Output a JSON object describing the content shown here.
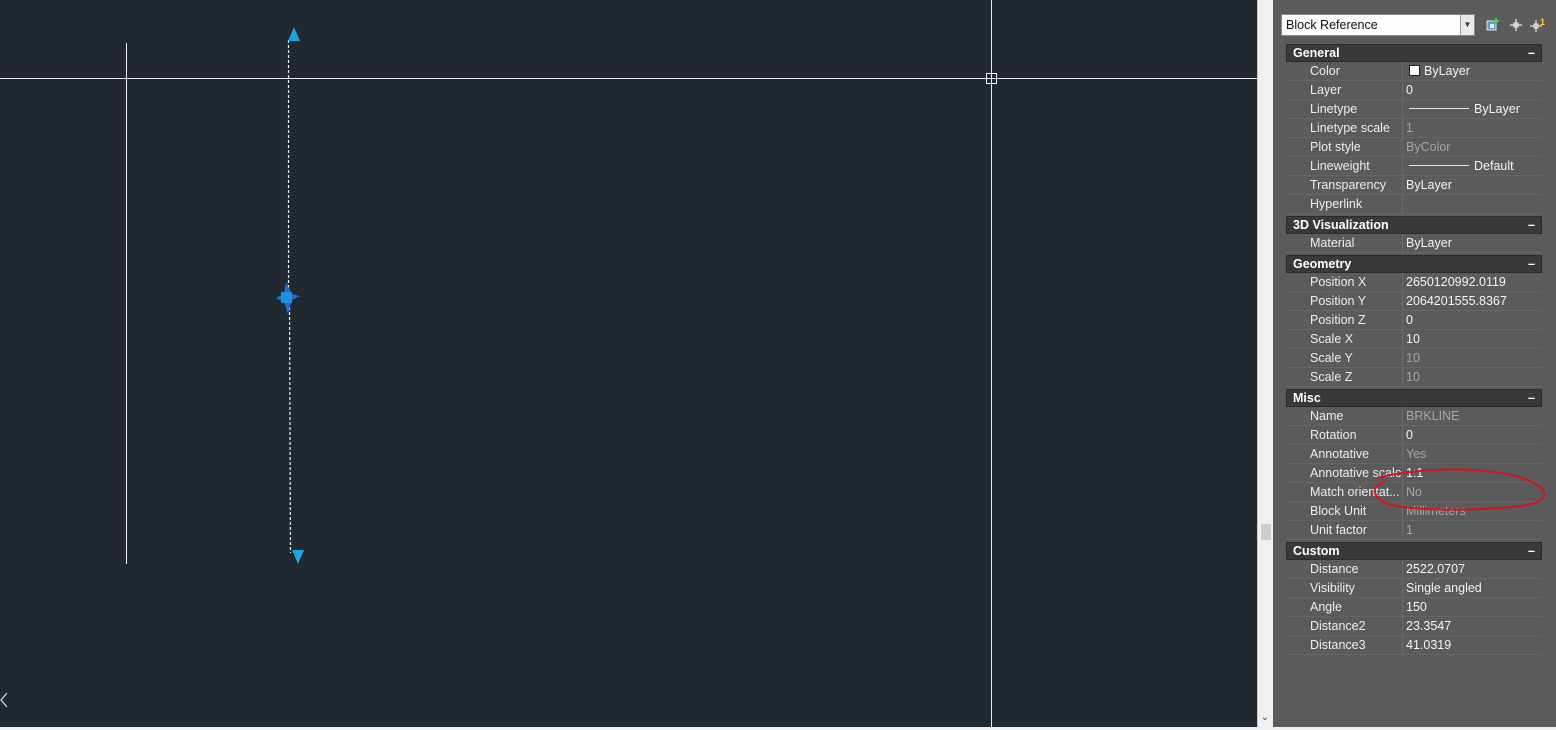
{
  "palette": {
    "object_type": "Block Reference",
    "toolbar": {
      "icons": [
        "quick-select-icon",
        "select-objects-icon",
        "toggle-pickadd-icon"
      ]
    },
    "categories": [
      {
        "title": "General",
        "collapse_symbol": "–",
        "rows": [
          {
            "name": "Color",
            "value": "ByLayer",
            "swatch": "#ffffff",
            "readonly": false
          },
          {
            "name": "Layer",
            "value": "0",
            "readonly": false
          },
          {
            "name": "Linetype",
            "value": "ByLayer",
            "line": true,
            "readonly": false
          },
          {
            "name": "Linetype scale",
            "value": "1",
            "readonly": true
          },
          {
            "name": "Plot style",
            "value": "ByColor",
            "readonly": true
          },
          {
            "name": "Lineweight",
            "value": "Default",
            "line": true,
            "readonly": false
          },
          {
            "name": "Transparency",
            "value": "ByLayer",
            "readonly": false
          },
          {
            "name": "Hyperlink",
            "value": "",
            "readonly": false
          }
        ]
      },
      {
        "title": "3D Visualization",
        "collapse_symbol": "–",
        "rows": [
          {
            "name": "Material",
            "value": "ByLayer",
            "readonly": false
          }
        ]
      },
      {
        "title": "Geometry",
        "collapse_symbol": "–",
        "rows": [
          {
            "name": "Position X",
            "value": "2650120992.0119",
            "readonly": false
          },
          {
            "name": "Position Y",
            "value": "2064201555.8367",
            "readonly": false
          },
          {
            "name": "Position Z",
            "value": "0",
            "readonly": false
          },
          {
            "name": "Scale X",
            "value": "10",
            "readonly": false
          },
          {
            "name": "Scale Y",
            "value": "10",
            "readonly": true
          },
          {
            "name": "Scale Z",
            "value": "10",
            "readonly": true
          }
        ]
      },
      {
        "title": "Misc",
        "collapse_symbol": "–",
        "rows": [
          {
            "name": "Name",
            "value": "BRKLINE",
            "readonly": true
          },
          {
            "name": "Rotation",
            "value": "0",
            "readonly": false
          },
          {
            "name": "Annotative",
            "value": "Yes",
            "readonly": true
          },
          {
            "name": "Annotative scale",
            "value": "1:1",
            "readonly": false
          },
          {
            "name": "Match orientat...",
            "value": "No",
            "readonly": true
          },
          {
            "name": "Block Unit",
            "value": "Millimeters",
            "readonly": true
          },
          {
            "name": "Unit factor",
            "value": "1",
            "readonly": true
          }
        ]
      },
      {
        "title": "Custom",
        "collapse_symbol": "–",
        "rows": [
          {
            "name": "Distance",
            "value": "2522.0707",
            "readonly": false
          },
          {
            "name": "Visibility",
            "value": "Single angled",
            "readonly": false
          },
          {
            "name": "Angle",
            "value": "150",
            "readonly": false
          },
          {
            "name": "Distance2",
            "value": "23.3547",
            "readonly": false
          },
          {
            "name": "Distance3",
            "value": "41.0319",
            "readonly": false
          }
        ]
      }
    ]
  },
  "canvas": {
    "background": "#212830",
    "grip_color": "#1fa2e0",
    "annotation_color": "#d2141c"
  }
}
